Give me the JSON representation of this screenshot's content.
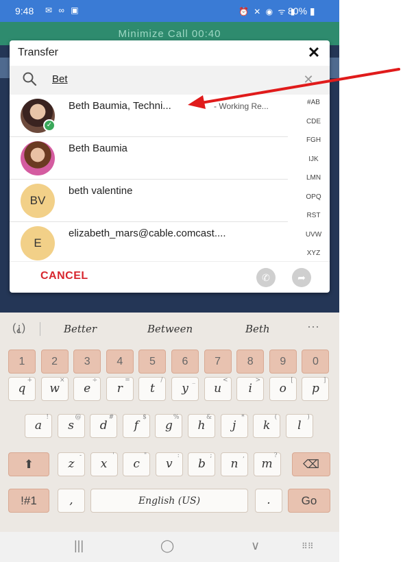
{
  "status_bar": {
    "time": "9:48",
    "notification_icons": "✉ ∞ ▣",
    "system_icons": "⏰ ✕ ◉ ᯤ ▮",
    "battery": "80% ▮"
  },
  "call_banner": {
    "text": "Minimize Call  00:40"
  },
  "dialog": {
    "title": "Transfer",
    "close_label": "✕",
    "search": {
      "value": "Bet",
      "clear_label": "✕"
    },
    "results": [
      {
        "name": "Beth Baumia, Techni...",
        "status": " - Working Re...",
        "avatar_type": "photo",
        "presence": "available"
      },
      {
        "name": "Beth Baumia",
        "avatar_type": "photo"
      },
      {
        "name": "beth valentine",
        "initials": "BV"
      },
      {
        "name": "elizabeth_mars@cable.comcast....",
        "initials": "E"
      }
    ],
    "alpha_index": [
      "#AB",
      "CDE",
      "FGH",
      "IJK",
      "LMN",
      "OPQ",
      "RST",
      "UVW",
      "XYZ"
    ],
    "cancel_label": "CANCEL",
    "transfer_icon": "phone-transfer-icon",
    "forward_icon": "forward-arrow-icon"
  },
  "keyboard": {
    "suggestions": [
      "Better",
      "Between",
      "Beth"
    ],
    "more_label": "···",
    "number_row": [
      "1",
      "2",
      "3",
      "4",
      "5",
      "6",
      "7",
      "8",
      "9",
      "0"
    ],
    "row1": [
      {
        "k": "q",
        "h": "+"
      },
      {
        "k": "w",
        "h": "×"
      },
      {
        "k": "e",
        "h": "÷"
      },
      {
        "k": "r",
        "h": "="
      },
      {
        "k": "t",
        "h": "/"
      },
      {
        "k": "y",
        "h": "_"
      },
      {
        "k": "u",
        "h": "<"
      },
      {
        "k": "i",
        "h": ">"
      },
      {
        "k": "o",
        "h": "["
      },
      {
        "k": "p",
        "h": "]"
      }
    ],
    "row2": [
      {
        "k": "a",
        "h": "!"
      },
      {
        "k": "s",
        "h": "@"
      },
      {
        "k": "d",
        "h": "#"
      },
      {
        "k": "f",
        "h": "$"
      },
      {
        "k": "g",
        "h": "%"
      },
      {
        "k": "h",
        "h": "&"
      },
      {
        "k": "j",
        "h": "*"
      },
      {
        "k": "k",
        "h": "("
      },
      {
        "k": "l",
        "h": ")"
      }
    ],
    "row3": [
      {
        "k": "z",
        "h": "-"
      },
      {
        "k": "x",
        "h": "'"
      },
      {
        "k": "c",
        "h": "\""
      },
      {
        "k": "v",
        "h": ":"
      },
      {
        "k": "b",
        "h": ";"
      },
      {
        "k": "n",
        "h": ","
      },
      {
        "k": "m",
        "h": "?"
      }
    ],
    "symbols_label": "!#1",
    "comma_label": ",",
    "space_label": "English (US)",
    "period_label": ".",
    "go_label": "Go",
    "shift_label": "⬆",
    "backspace_label": "⌫"
  },
  "nav_bar": {
    "recents": "|||",
    "home": "◯",
    "back": "∨",
    "keyboard": "⠿⠿"
  },
  "colors": {
    "accent_red": "#d7262e",
    "call_green": "#2e8b6e",
    "status_blue": "#3a7bd5",
    "annotation_arrow": "#e01b1b"
  }
}
